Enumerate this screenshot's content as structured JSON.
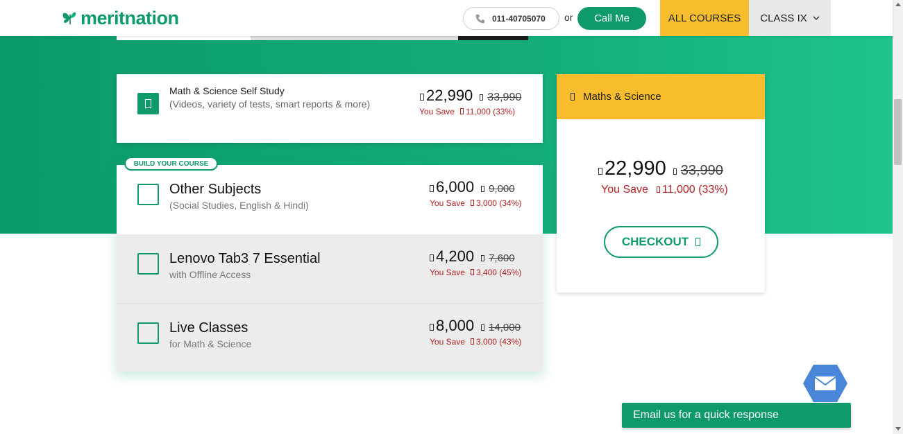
{
  "header": {
    "logo_text": "meritnation",
    "phone": "011-40705070",
    "or_text": "or",
    "call_me": "Call Me",
    "all_courses": "ALL COURSES",
    "class_label": "CLASS IX"
  },
  "self_study": {
    "title": "Math & Science Self Study",
    "subtitle": "(Videos, variety of tests, smart reports & more)",
    "price": "22,990",
    "old_price": "33,990",
    "you_save_label": "You Save",
    "save_amount": "11,000 (33%)"
  },
  "build_course": {
    "badge": "BUILD YOUR COURSE",
    "items": [
      {
        "title": "Other Subjects",
        "subtitle": "(Social Studies, English & Hindi)",
        "price": "6,000",
        "old_price": "9,000",
        "you_save_label": "You Save",
        "save_amount": "3,000 (34%)"
      },
      {
        "title": "Lenovo Tab3 7 Essential",
        "subtitle": "with Offline Access",
        "price": "4,200",
        "old_price": "7,600",
        "you_save_label": "You Save",
        "save_amount": "3,400 (45%)"
      },
      {
        "title": "Live Classes",
        "subtitle": "for Math & Science",
        "price": "8,000",
        "old_price": "14,000",
        "you_save_label": "You Save",
        "save_amount": "3,000 (43%)"
      }
    ]
  },
  "summary": {
    "heading": "Maths & Science",
    "price": "22,990",
    "old_price": "33,990",
    "you_save_label": "You Save",
    "save_amount": "11,000 (33%)",
    "checkout": "CHECKOUT"
  },
  "email": {
    "label": "Email us for a quick response"
  },
  "colors": {
    "brand_green": "#0f9a6c",
    "accent_yellow": "#f7bd2c",
    "save_red": "#b22222"
  },
  "icons": [
    "butterfly-logo-icon",
    "phone-icon",
    "chevron-down-icon",
    "rupee-icon",
    "checkbox-icon",
    "bag-icon",
    "arrow-right-icon",
    "mail-icon"
  ]
}
